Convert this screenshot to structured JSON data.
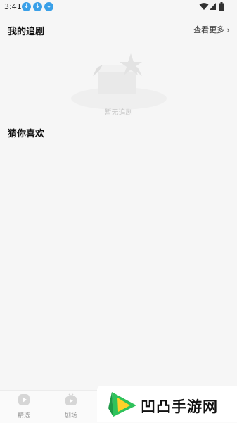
{
  "status_bar": {
    "time": "3:41",
    "notifications": [
      "download-icon",
      "download-icon",
      "download-icon"
    ],
    "system_icons": [
      "wifi-icon",
      "signal-icon",
      "battery-icon"
    ]
  },
  "my_dramas": {
    "title": "我的追剧",
    "see_more": "查看更多",
    "empty_text": "暂无追剧"
  },
  "recommend": {
    "title": "猜你喜欢"
  },
  "tab_bar": {
    "tabs": [
      {
        "label": "精选",
        "icon": "play-circle-icon"
      },
      {
        "label": "剧场",
        "icon": "tv-icon"
      }
    ]
  },
  "watermark": {
    "text": "凹凸手游网"
  },
  "colors": {
    "accent": "#3aa0e8",
    "background": "#f6f6f6",
    "tab_text": "#9a9a9a"
  }
}
